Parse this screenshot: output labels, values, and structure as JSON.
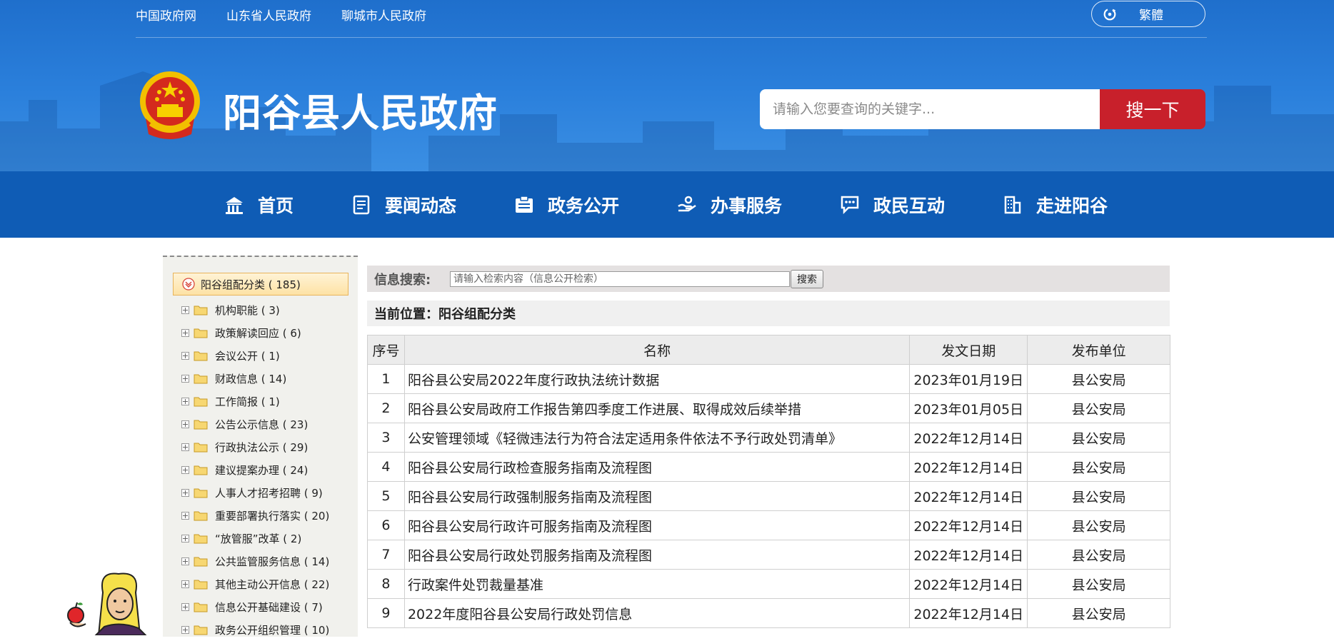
{
  "top_links": [
    "中国政府网",
    "山东省人民政府",
    "聊城市人民政府"
  ],
  "lang_label": "繁體",
  "site_title": "阳谷县人民政府",
  "search": {
    "placeholder": "请输入您要查询的关键字...",
    "button": "搜一下"
  },
  "nav": [
    {
      "label": "首页",
      "icon": "home-icon"
    },
    {
      "label": "要闻动态",
      "icon": "news-icon"
    },
    {
      "label": "政务公开",
      "icon": "gov-affairs-icon"
    },
    {
      "label": "办事服务",
      "icon": "service-icon"
    },
    {
      "label": "政民互动",
      "icon": "chat-icon"
    },
    {
      "label": "走进阳谷",
      "icon": "building-icon"
    }
  ],
  "sidebar": {
    "root": "阳谷组配分类 ( 185)",
    "items": [
      "机构职能 ( 3)",
      "政策解读回应 ( 6)",
      "会议公开 ( 1)",
      "财政信息 ( 14)",
      "工作简报 ( 1)",
      "公告公示信息 ( 23)",
      "行政执法公示 ( 29)",
      "建议提案办理 ( 24)",
      "人事人才招考招聘 ( 9)",
      "重要部署执行落实 ( 20)",
      "“放管服”改革 ( 2)",
      "公共监管服务信息 ( 14)",
      "其他主动公开信息 ( 22)",
      "信息公开基础建设 ( 7)",
      "政务公开组织管理 ( 10)"
    ]
  },
  "info_search": {
    "label": "信息搜索:",
    "placeholder": "请输入检索内容（信息公开检索）",
    "button": "搜索"
  },
  "breadcrumb": "当前位置：阳谷组配分类",
  "table": {
    "headers": [
      "序号",
      "名称",
      "发文日期",
      "发布单位"
    ],
    "rows": [
      [
        "1",
        "阳谷县公安局2022年度行政执法统计数据",
        "2023年01月19日",
        "县公安局"
      ],
      [
        "2",
        "阳谷县公安局政府工作报告第四季度工作进展、取得成效后续举措",
        "2023年01月05日",
        "县公安局"
      ],
      [
        "3",
        "公安管理领域《轻微违法行为符合法定适用条件依法不予行政处罚清单》",
        "2022年12月14日",
        "县公安局"
      ],
      [
        "4",
        "阳谷县公安局行政检查服务指南及流程图",
        "2022年12月14日",
        "县公安局"
      ],
      [
        "5",
        "阳谷县公安局行政强制服务指南及流程图",
        "2022年12月14日",
        "县公安局"
      ],
      [
        "6",
        "阳谷县公安局行政许可服务指南及流程图",
        "2022年12月14日",
        "县公安局"
      ],
      [
        "7",
        "阳谷县公安局行政处罚服务指南及流程图",
        "2022年12月14日",
        "县公安局"
      ],
      [
        "8",
        "行政案件处罚裁量基准",
        "2022年12月14日",
        "县公安局"
      ],
      [
        "9",
        "2022年度阳谷县公安局行政处罚信息",
        "2022年12月14日",
        "县公安局"
      ]
    ]
  },
  "colors": {
    "header_blue": "#2b80dc",
    "nav_blue": "#0f5cb5",
    "search_red": "#c8202b"
  }
}
